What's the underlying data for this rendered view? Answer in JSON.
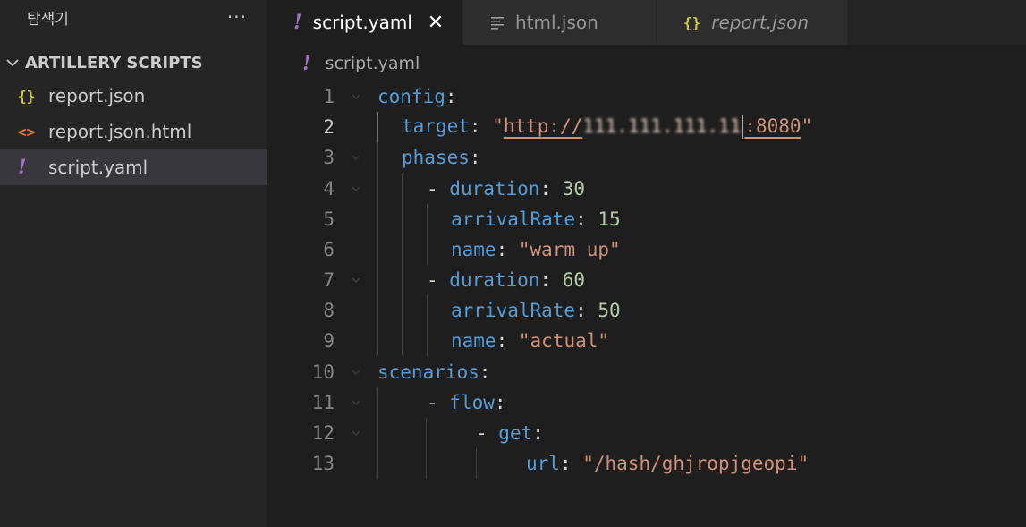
{
  "sidebar": {
    "title": "탐색기",
    "more_label": "···",
    "section": "ARTILLERY SCRIPTS",
    "files": [
      {
        "name": "report.json",
        "icon": "json-icon",
        "glyph": "{}"
      },
      {
        "name": "report.json.html",
        "icon": "html-icon",
        "glyph": "<>"
      },
      {
        "name": "script.yaml",
        "icon": "yaml-icon",
        "glyph": "!"
      }
    ]
  },
  "tabs": [
    {
      "label": "script.yaml",
      "icon": "yaml-icon",
      "glyph": "!",
      "active": true,
      "close": "✕"
    },
    {
      "label": "html.json",
      "icon": "text-lines-icon",
      "glyph": "≡",
      "active": false
    },
    {
      "label": "report.json",
      "icon": "json-icon",
      "glyph": "{}",
      "active": false,
      "preview": true
    }
  ],
  "breadcrumb": {
    "glyph": "!",
    "label": "script.yaml"
  },
  "editor": {
    "current_line": 2,
    "lines": [
      {
        "no": "1"
      },
      {
        "no": "2"
      },
      {
        "no": "3"
      },
      {
        "no": "4"
      },
      {
        "no": "5"
      },
      {
        "no": "6"
      },
      {
        "no": "7"
      },
      {
        "no": "8"
      },
      {
        "no": "9"
      },
      {
        "no": "10"
      },
      {
        "no": "11"
      },
      {
        "no": "12"
      },
      {
        "no": "13"
      }
    ],
    "tokens": {
      "l1": {
        "key": "config",
        "colon": ":"
      },
      "l2": {
        "key": "target",
        "colon": ": ",
        "q": "\"",
        "url_a": "http://",
        "url_blur": "111.111.111.11",
        "url_b": ":8080",
        "q2": "\""
      },
      "l3": {
        "key": "phases",
        "colon": ":"
      },
      "l4": {
        "dash": "- ",
        "key": "duration",
        "colon": ": ",
        "val": "30"
      },
      "l5": {
        "key": "arrivalRate",
        "colon": ": ",
        "val": "15"
      },
      "l6": {
        "key": "name",
        "colon": ": ",
        "val": "\"warm up\""
      },
      "l7": {
        "dash": "- ",
        "key": "duration",
        "colon": ": ",
        "val": "60"
      },
      "l8": {
        "key": "arrivalRate",
        "colon": ": ",
        "val": "50"
      },
      "l9": {
        "key": "name",
        "colon": ": ",
        "val": "\"actual\""
      },
      "l10": {
        "key": "scenarios",
        "colon": ":"
      },
      "l11": {
        "dash": "- ",
        "key": "flow",
        "colon": ":"
      },
      "l12": {
        "dash": "- ",
        "key": "get",
        "colon": ":"
      },
      "l13": {
        "key": "url",
        "colon": ": ",
        "val": "\"/hash/ghjropjgeopi\""
      }
    }
  },
  "colors": {
    "keyword": "#569cd6",
    "string": "#ce9178",
    "number": "#b5cea8",
    "json_icon": "#cbcb41",
    "html_icon": "#e37933",
    "yaml_icon": "#a074c4"
  }
}
